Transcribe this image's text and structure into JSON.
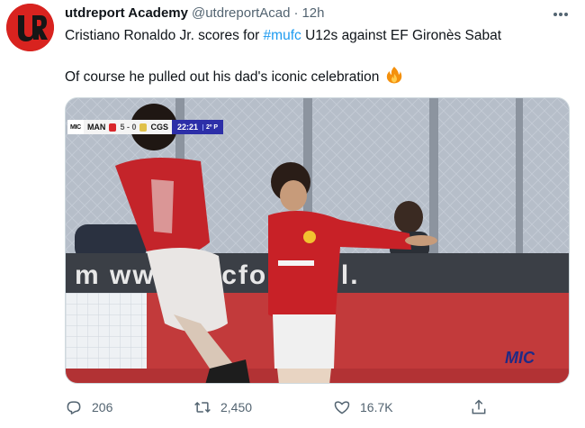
{
  "tweet": {
    "display_name": "utdreport Academy",
    "handle": "@utdreportAcad",
    "separator": "·",
    "time": "12h",
    "line1_prefix": "Cristiano Ronaldo Jr. scores for ",
    "line1_hashtag": "#mufc",
    "line1_suffix": " U12s against EF Gironès Sabat",
    "line2": "Of course he pulled out his dad's iconic celebration",
    "line2_emoji": "🔥"
  },
  "media": {
    "type": "video-still",
    "banner_text": "m  www.micfootball.",
    "watermark": "MIC",
    "scorebug": {
      "logo": "MIC",
      "home": "MAN",
      "score": "5 - 0",
      "away": "CGS",
      "clock": "22:21",
      "half": "2º P"
    }
  },
  "actions": {
    "reply_count": "206",
    "retweet_count": "2,450",
    "like_count": "16.7K"
  },
  "icons": {
    "avatar": "utdreport-logo",
    "more": "more-horizontal-icon",
    "reply": "reply-icon",
    "retweet": "retweet-icon",
    "like": "heart-icon",
    "share": "share-icon"
  },
  "colors": {
    "accent": "#1d9bf0",
    "text_primary": "#0f1419",
    "text_secondary": "#536471",
    "avatar_bg": "#d8231f",
    "scorebug_blue": "#2d2fa8"
  }
}
